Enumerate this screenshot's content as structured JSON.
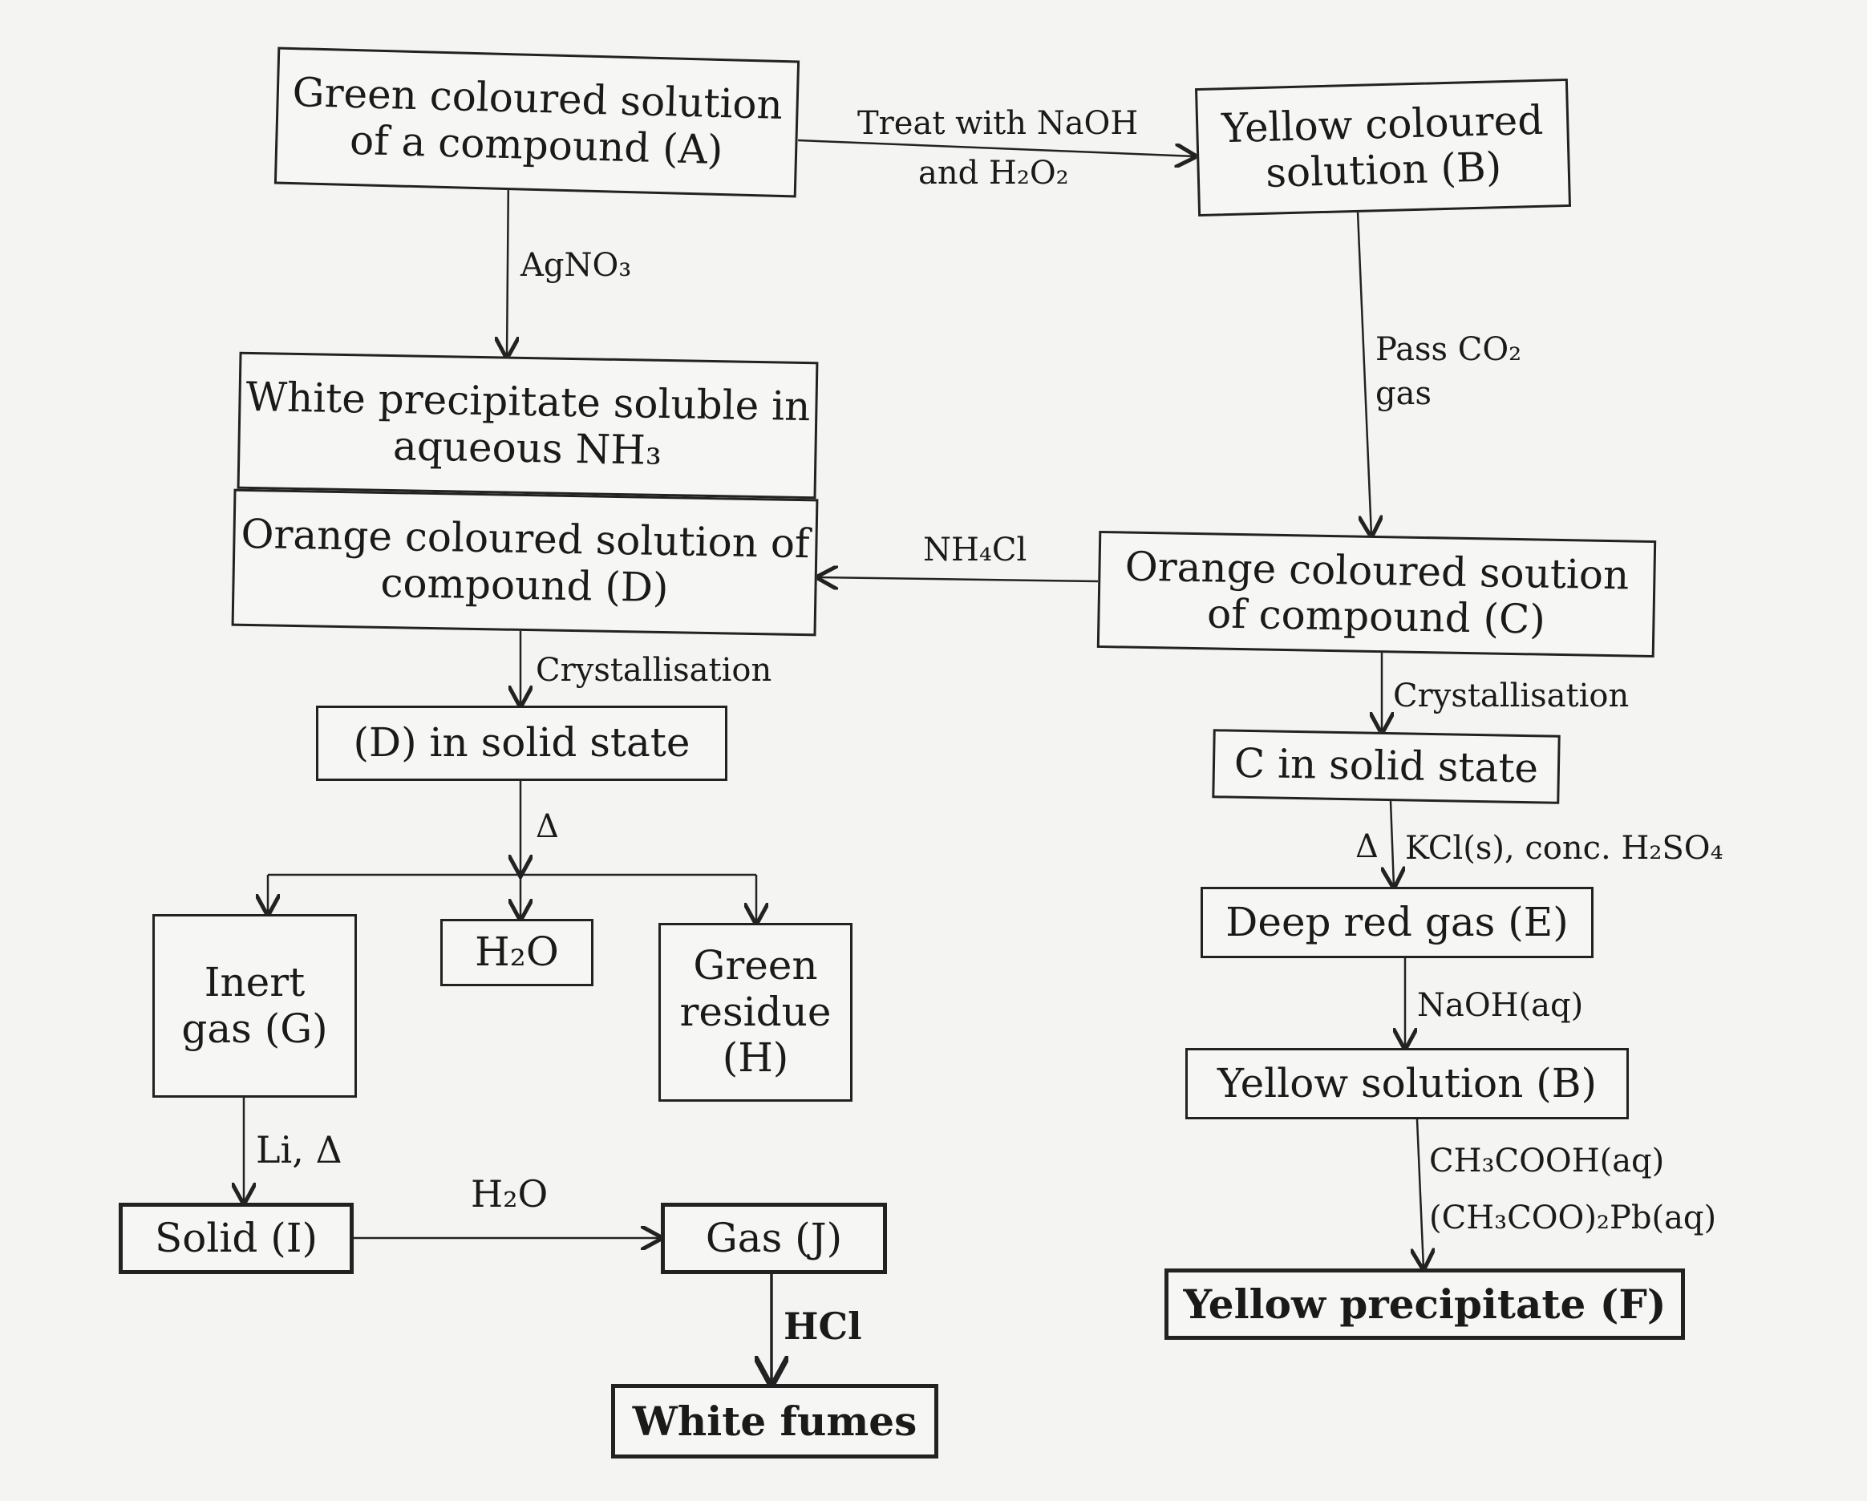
{
  "nodes": {
    "A": "Green coloured solution of a compound (A)",
    "B": "Yellow coloured solution (B)",
    "white_ppt": "White precipitate soluble in aqueous NH₃",
    "D": "Orange coloured solution of compound (D)",
    "C": "Orange coloured soution of compound (C)",
    "D_solid": "(D) in solid state",
    "C_solid": "C in solid state",
    "G": "Inert gas (G)",
    "water": "H₂O",
    "H": "Green residue (H)",
    "E": "Deep red gas (E)",
    "B2": "Yellow solution (B)",
    "I": "Solid (I)",
    "J": "Gas (J)",
    "F": "Yellow precipitate (F)",
    "fumes": "White fumes"
  },
  "edges": {
    "a_to_b_line1": "Treat with NaOH",
    "a_to_b_line2": "and H₂O₂",
    "agno3": "AgNO₃",
    "pass_co2_line1": "Pass CO₂",
    "pass_co2_line2": "gas",
    "nh4cl": "NH₄Cl",
    "cryst_d": "Crystallisation",
    "cryst_c": "Crystallisation",
    "heat_d": "Δ",
    "heat_c": "Δ",
    "kcl": "KCl(s), conc. H₂SO₄",
    "naoh": "NaOH(aq)",
    "acetic_line1": "CH₃COOH(aq)",
    "acetic_line2": "(CH₃COO)₂Pb(aq)",
    "li": "Li, Δ",
    "h2o": "H₂O",
    "hcl": "HCl"
  }
}
